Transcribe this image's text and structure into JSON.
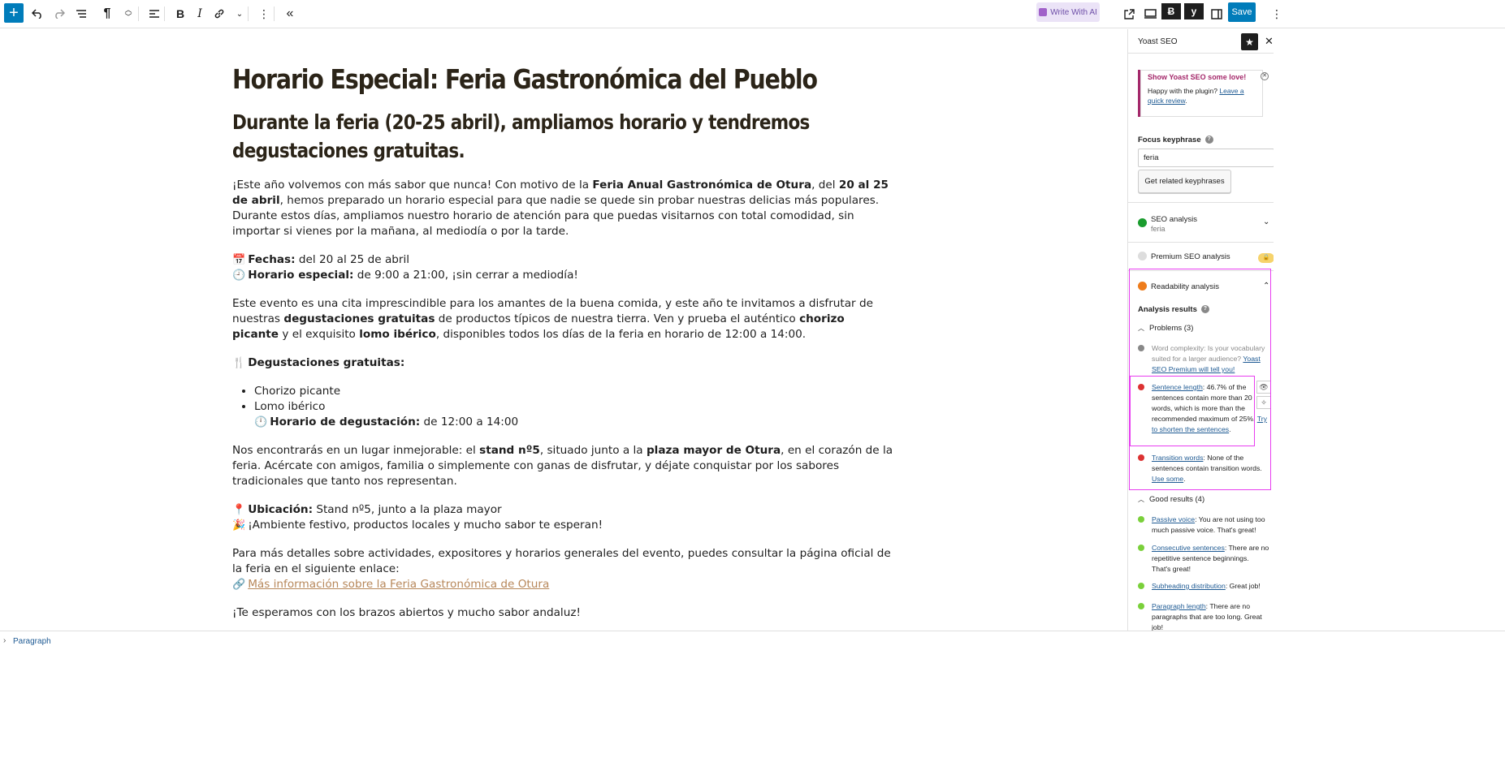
{
  "toolbar": {
    "write_ai_label": "Write With AI",
    "save_label": "Save"
  },
  "post": {
    "title": "Horario Especial: Feria Gastronómica del Pueblo",
    "subtitle": "Durante la feria (20-25 abril), ampliamos horario y tendremos degustaciones gratuitas.",
    "p1": {
      "a": "¡Este año volvemos con más sabor que nunca! Con motivo de la ",
      "b": "Feria Anual Gastronómica de Otura",
      "c": ", del ",
      "d": "20 al 25 de abril",
      "e": ", hemos preparado un horario especial para que nadie se quede sin probar nuestras delicias más populares. Durante estos días, ampliamos nuestro horario de atención para que puedas visitarnos con total comodidad, sin importar si vienes por la mañana, al mediodía o por la tarde."
    },
    "fechas": {
      "emoji": "📅",
      "label": "Fechas:",
      "value": " del 20 al 25 de abril"
    },
    "horario": {
      "emoji": "🕘",
      "label": "Horario especial:",
      "value": " de 9:00 a 21:00, ¡sin cerrar a mediodía!"
    },
    "p2": {
      "a": "Este evento es una cita imprescindible para los amantes de la buena comida, y este año te invitamos a disfrutar de nuestras ",
      "b": "degustaciones gratuitas",
      "c": " de productos típicos de nuestra tierra. Ven y prueba el auténtico ",
      "d": "chorizo picante",
      "e": " y el exquisito ",
      "f": "lomo ibérico",
      "g": ", disponibles todos los días de la feria en horario de 12:00 a 14:00."
    },
    "degustaciones": {
      "emoji": "🍴",
      "label": "Degustaciones gratuitas:"
    },
    "list": [
      "Chorizo picante",
      "Lomo ibérico"
    ],
    "horario_degustacion": {
      "emoji": "🕛",
      "label": "Horario de degustación:",
      "value": " de 12:00 a 14:00"
    },
    "p3": {
      "a": "Nos encontrarás en un lugar inmejorable: el ",
      "b": "stand nº5",
      "c": ", situado junto a la ",
      "d": "plaza mayor de Otura",
      "e": ", en el corazón de la feria. Acércate con amigos, familia o simplemente con ganas de disfrutar, y déjate conquistar por los sabores tradicionales que tanto nos representan."
    },
    "ubicacion": {
      "emoji": "📍",
      "label": "Ubicación:",
      "value": " Stand nº5, junto a la plaza mayor"
    },
    "ambiente": {
      "emoji": "🎉",
      "value": "¡Ambiente festivo, productos locales y mucho sabor te esperan!"
    },
    "p4": "Para más detalles sobre actividades, expositores y horarios generales del evento, puedes consultar la página oficial de la feria en el siguiente enlace:",
    "link": {
      "emoji": "🔗",
      "text": "Más información sobre la Feria Gastronómica de Otura"
    },
    "p5": "¡Te esperamos con los brazos abiertos y mucho sabor andaluz!"
  },
  "statusbar": {
    "breadcrumb": "Paragraph"
  },
  "sidebar": {
    "title": "Yoast SEO",
    "love": {
      "title": "Show Yoast SEO some love!",
      "text": "Happy with the plugin? ",
      "link": "Leave a quick review",
      "end": "."
    },
    "focus_label": "Focus keyphrase",
    "focus_value": "feria",
    "related_button": "Get related keyphrases",
    "seo_analysis": {
      "label": "SEO analysis",
      "sub": "feria"
    },
    "premium_seo": "Premium SEO analysis",
    "readability": "Readability analysis",
    "analysis_results": "Analysis results",
    "problems_label": "Problems (3)",
    "problems": [
      {
        "link": "",
        "text": "Word complexity: Is your vocabulary suited for a larger audience? ",
        "link2": "Yoast SEO Premium will tell you!",
        "color": "#888888"
      },
      {
        "link": "Sentence length",
        "text": ": 46.7% of the sentences contain more than 20 words, which is more than the recommended maximum of 25%. ",
        "link2": "Try to shorten the sentences",
        "end": ".",
        "color": "#dc3232"
      },
      {
        "link": "Transition words",
        "text": ": None of the sentences contain transition words. ",
        "link2": "Use some",
        "end": ".",
        "color": "#dc3232"
      }
    ],
    "good_label": "Good results (4)",
    "good": [
      {
        "link": "Passive voice",
        "text": ": You are not using too much passive voice. That's great!"
      },
      {
        "link": "Consecutive sentences",
        "text": ": There are no repetitive sentence beginnings. That's great!"
      },
      {
        "link": "Subheading distribution",
        "text": ": Great job!"
      },
      {
        "link": "Paragraph length",
        "text": ": There are no paragraphs that are too long. Great job!"
      }
    ]
  }
}
